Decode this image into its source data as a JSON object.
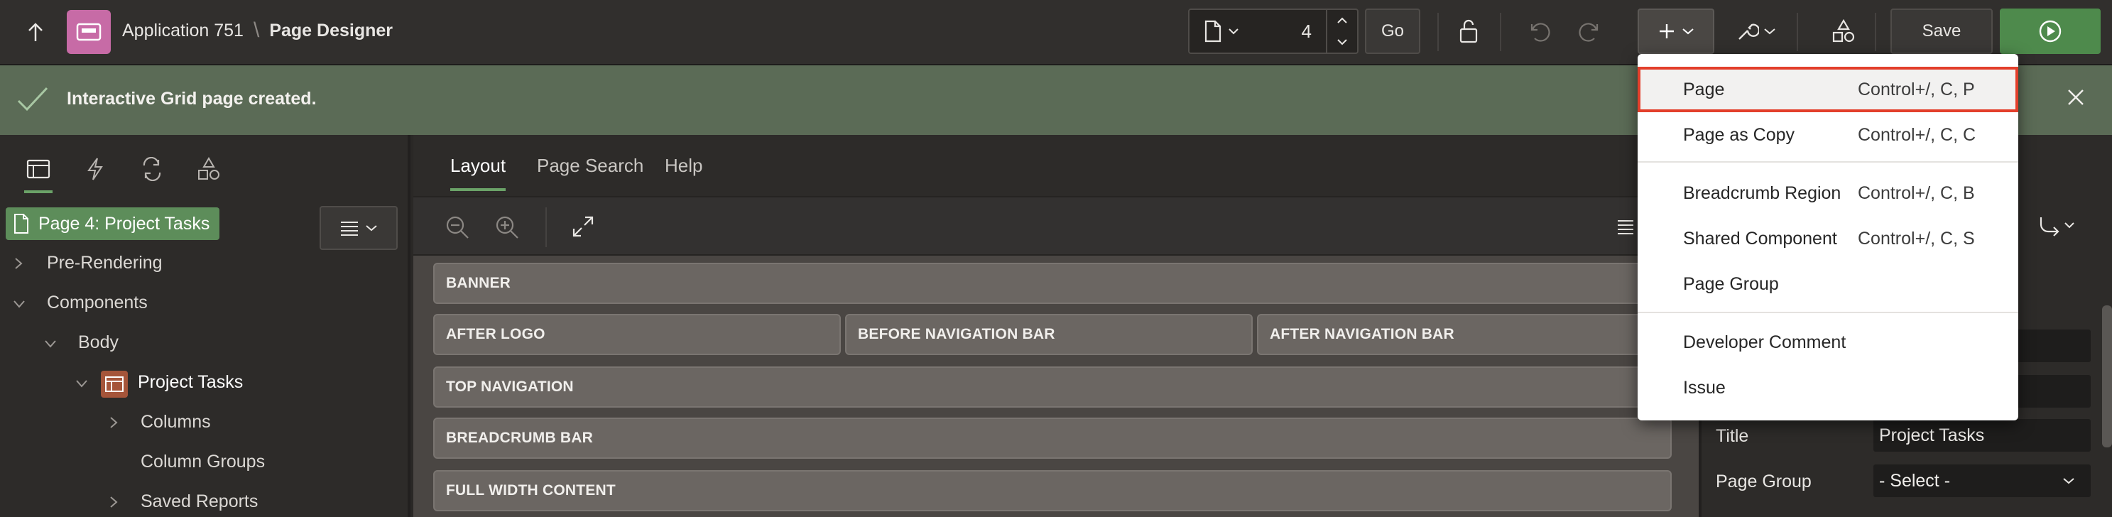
{
  "header": {
    "app_name": "Application 751",
    "separator": "\\",
    "page_title": "Page Designer",
    "page_number": "4",
    "go_label": "Go",
    "save_label": "Save"
  },
  "notification": {
    "message": "Interactive Grid page created."
  },
  "left_panel": {
    "page_node": "Page 4: Project Tasks",
    "tree": [
      {
        "label": "Pre-Rendering"
      },
      {
        "label": "Components"
      },
      {
        "label": "Body"
      },
      {
        "label": "Project Tasks"
      },
      {
        "label": "Columns"
      },
      {
        "label": "Column Groups"
      },
      {
        "label": "Saved Reports"
      }
    ]
  },
  "center": {
    "tabs": [
      {
        "label": "Layout"
      },
      {
        "label": "Page Search"
      },
      {
        "label": "Help"
      }
    ],
    "regions": {
      "banner": "BANNER",
      "after_logo": "AFTER LOGO",
      "before_nav": "BEFORE NAVIGATION BAR",
      "after_nav": "AFTER NAVIGATION BAR",
      "top_nav": "TOP NAVIGATION",
      "breadcrumb_bar": "BREADCRUMB BAR",
      "full_width": "FULL WIDTH CONTENT"
    }
  },
  "properties": {
    "title_label": "Title",
    "title_value": "Project Tasks",
    "page_group_label": "Page Group",
    "page_group_value": "- Select -"
  },
  "create_menu": {
    "items": [
      {
        "label": "Page",
        "shortcut": "Control+/, C, P"
      },
      {
        "label": "Page as Copy",
        "shortcut": "Control+/, C, C"
      },
      {
        "label": "Breadcrumb Region",
        "shortcut": "Control+/, C, B"
      },
      {
        "label": "Shared Component",
        "shortcut": "Control+/, C, S"
      },
      {
        "label": "Page Group",
        "shortcut": ""
      },
      {
        "label": "Developer Comment",
        "shortcut": ""
      },
      {
        "label": "Issue",
        "shortcut": ""
      }
    ]
  },
  "colors": {
    "accent_green": "#6ba368",
    "success_bar": "#5b6b56",
    "app_icon": "#c76ba6",
    "highlight_border": "#e33f2b"
  }
}
